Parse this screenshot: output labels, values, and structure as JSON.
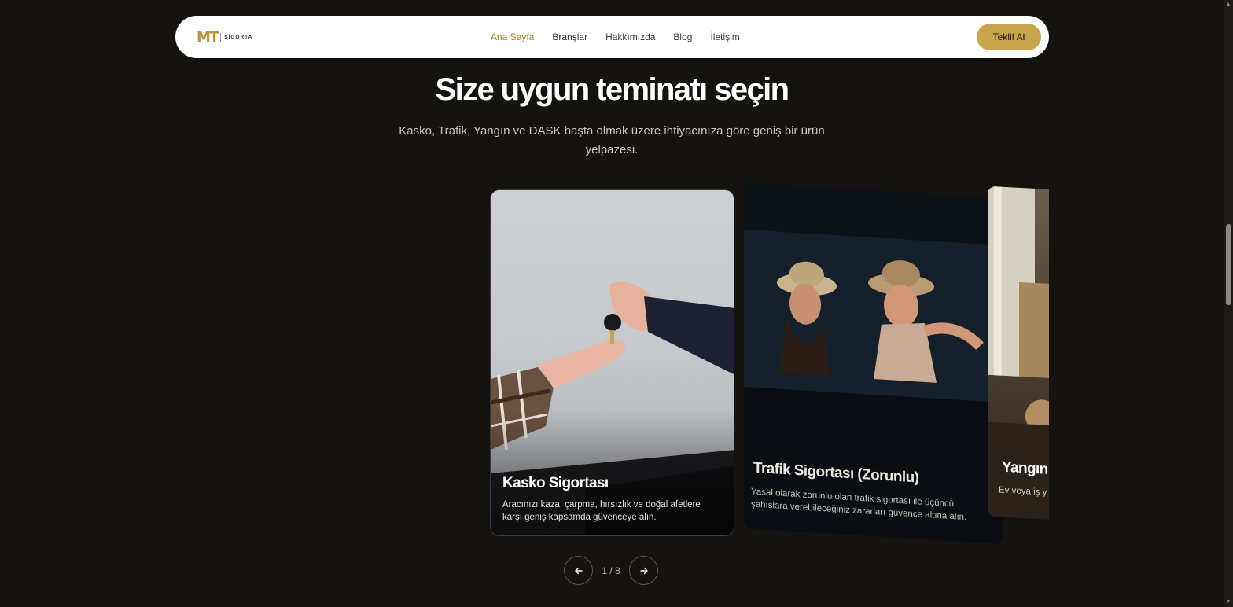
{
  "brand": {
    "mark": "MT",
    "name": "SİGORTA"
  },
  "nav": {
    "items": [
      {
        "label": "Ana Sayfa",
        "active": true
      },
      {
        "label": "Branşlar",
        "active": false
      },
      {
        "label": "Hakkımızda",
        "active": false
      },
      {
        "label": "Blog",
        "active": false
      },
      {
        "label": "İletişim",
        "active": false
      }
    ],
    "cta_label": "Teklif Al"
  },
  "hero": {
    "title": "Size uygun teminatı seçin",
    "subtitle": "Kasko, Trafik, Yangın ve DASK başta olmak üzere ihtiyacınıza göre geniş bir ürün yelpazesi."
  },
  "cards": [
    {
      "title": "Kasko Sigortası",
      "description": "Aracınızı kaza, çarpma, hırsızlık ve doğal afetlere karşı geniş kapsamda güvenceye alın."
    },
    {
      "title": "Trafik Sigortası (Zorunlu)",
      "description": "Yasal olarak zorunlu olan trafik sigortası ile üçüncü şahıslara verebileceğiniz zararları güvence altına alın."
    },
    {
      "title": "Yangın",
      "description": "Ev veya iş y tehlikelere k"
    }
  ],
  "pager": {
    "current": "1 / 8",
    "prev_icon": "arrow-left-icon",
    "next_icon": "arrow-right-icon"
  },
  "colors": {
    "accent": "#c9a44c",
    "active_link": "#a5802b",
    "background": "#15130f"
  }
}
